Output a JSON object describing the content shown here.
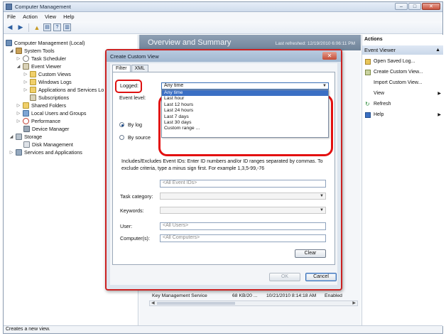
{
  "window": {
    "title": "Computer Management",
    "min": "–",
    "max": "□",
    "close": "✕"
  },
  "menu": [
    "File",
    "Action",
    "View",
    "Help"
  ],
  "tree": {
    "root": "Computer Management (Local)",
    "system_tools": "System Tools",
    "task_scheduler": "Task Scheduler",
    "event_viewer": "Event Viewer",
    "custom_views": "Custom Views",
    "windows_logs": "Windows Logs",
    "app_services": "Applications and Services Lo",
    "subscriptions": "Subscriptions",
    "shared_folders": "Shared Folders",
    "local_users": "Local Users and Groups",
    "performance": "Performance",
    "device_manager": "Device Manager",
    "storage": "Storage",
    "disk_management": "Disk Management",
    "services_apps": "Services and Applications"
  },
  "center": {
    "title": "Overview and Summary",
    "refreshed": "Last refreshed: 12/19/2010 6:06:11 PM",
    "service_row": {
      "name": "Key Management Service",
      "size": "68 KB/20 ...",
      "date": "10/21/2010 8:14:18 AM",
      "status": "Enabled"
    }
  },
  "actions": {
    "title": "Actions",
    "group": "Event Viewer",
    "items": [
      "Open Saved Log...",
      "Create Custom View...",
      "Import Custom View...",
      "View",
      "Refresh",
      "Help"
    ]
  },
  "status": "Creates a new view.",
  "dialog": {
    "title": "Create Custom View",
    "close": "✕",
    "tabs": [
      "Filter",
      "XML"
    ],
    "logged_label": "Logged:",
    "logged_value": "Any time",
    "options": [
      "Any time",
      "Last hour",
      "Last 12 hours",
      "Last 24 hours",
      "Last 7 days",
      "Last 30 days",
      "Custom range ..."
    ],
    "event_level_label": "Event level:",
    "by_log": "By log",
    "by_source": "By source",
    "description": "Includes/Excludes Event IDs: Enter ID numbers and/or ID ranges separated by commas. To exclude criteria, type a minus sign first. For example 1,3,5-99,-76",
    "event_ids_placeholder": "<All Event IDs>",
    "task_category_label": "Task category:",
    "keywords_label": "Keywords:",
    "user_label": "User:",
    "user_placeholder": "<All Users>",
    "computer_label": "Computer(s):",
    "computer_placeholder": "<All Computers>",
    "clear": "Clear",
    "ok": "OK",
    "cancel": "Cancel"
  }
}
